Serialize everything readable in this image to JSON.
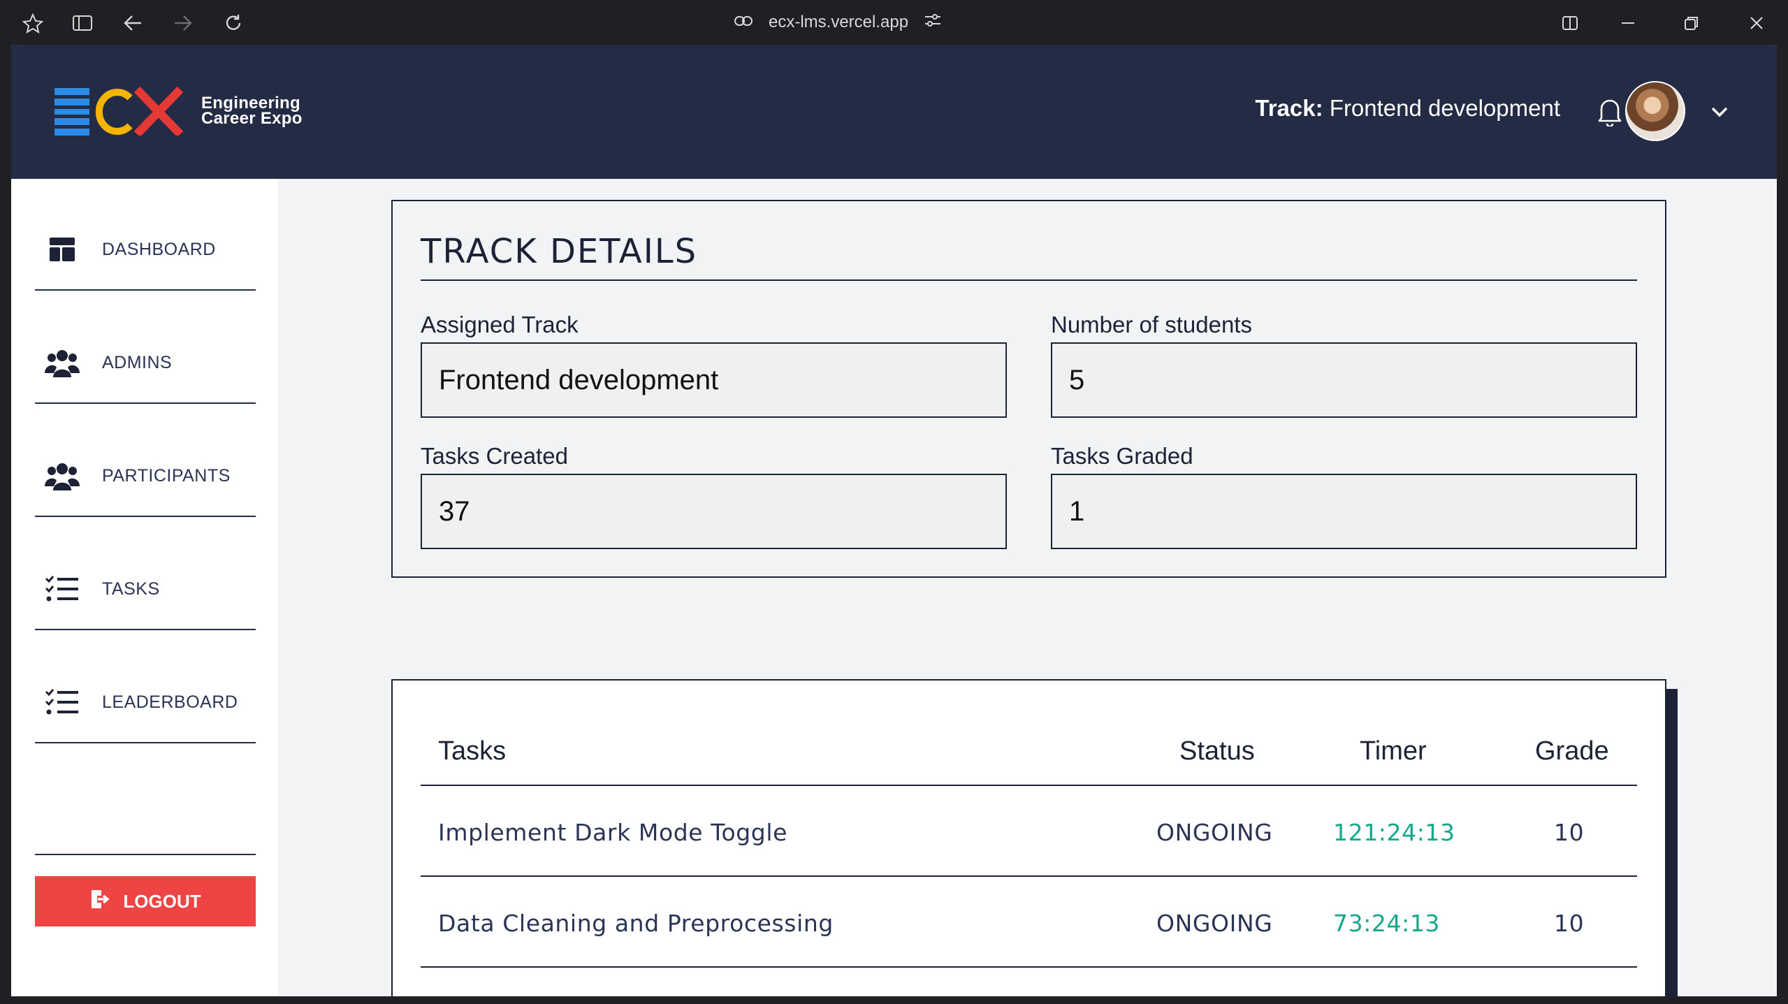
{
  "browser": {
    "url": "ecx-lms.vercel.app"
  },
  "header": {
    "logo_text_line1": "Engineering",
    "logo_text_line2": "Career Expo",
    "track_label": "Track:",
    "track_value": "Frontend development"
  },
  "sidebar": {
    "items": [
      {
        "label": "DASHBOARD",
        "icon": "dashboard-icon"
      },
      {
        "label": "ADMINS",
        "icon": "users-icon"
      },
      {
        "label": "PARTICIPANTS",
        "icon": "users-icon"
      },
      {
        "label": "TASKS",
        "icon": "checklist-icon"
      },
      {
        "label": "LEADERBOARD",
        "icon": "checklist-icon"
      }
    ],
    "logout_label": "LOGOUT"
  },
  "details": {
    "title": "TRACK DETAILS",
    "assigned_track_label": "Assigned Track",
    "assigned_track_value": "Frontend development",
    "students_label": "Number of students",
    "students_value": "5",
    "tasks_created_label": "Tasks Created",
    "tasks_created_value": "37",
    "tasks_graded_label": "Tasks Graded",
    "tasks_graded_value": "1"
  },
  "tasks_table": {
    "columns": [
      "Tasks",
      "Status",
      "Timer",
      "Grade"
    ],
    "rows": [
      {
        "task": "Implement Dark Mode Toggle",
        "status": "ONGOING",
        "timer": "121:24:13",
        "grade": "10"
      },
      {
        "task": "Data Cleaning and Preprocessing",
        "status": "ONGOING",
        "timer": "73:24:13",
        "grade": "10"
      }
    ]
  },
  "colors": {
    "header_bg": "#242b45",
    "logout_bg": "#ef4444",
    "timer": "#14a88a",
    "logo_blue": "#2b8be6",
    "logo_yellow": "#f4b400",
    "logo_red": "#e53935"
  }
}
